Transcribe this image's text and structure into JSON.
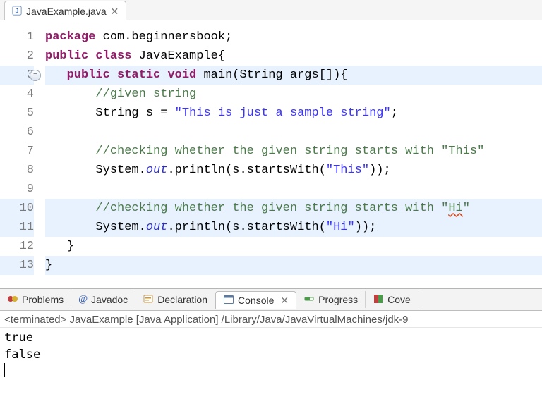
{
  "editor": {
    "filename": "JavaExample.java",
    "lines": [
      {
        "n": "1",
        "hl": false,
        "tokens": [
          {
            "t": "kw",
            "v": "package"
          },
          {
            "t": "id",
            "v": " com"
          },
          {
            "t": "id",
            "v": ".beginnersbook;"
          }
        ]
      },
      {
        "n": "2",
        "hl": false,
        "tokens": [
          {
            "t": "kw",
            "v": "public"
          },
          {
            "t": "id",
            "v": " "
          },
          {
            "t": "kw",
            "v": "class"
          },
          {
            "t": "id",
            "v": " JavaExample{"
          }
        ]
      },
      {
        "n": "3",
        "hl": true,
        "fold": true,
        "indent": "   ",
        "tokens": [
          {
            "t": "kw",
            "v": "public"
          },
          {
            "t": "id",
            "v": " "
          },
          {
            "t": "kw",
            "v": "static"
          },
          {
            "t": "id",
            "v": " "
          },
          {
            "t": "kw",
            "v": "void"
          },
          {
            "t": "id",
            "v": " main(String args[]){"
          }
        ]
      },
      {
        "n": "4",
        "hl": false,
        "indent": "       ",
        "tokens": [
          {
            "t": "cm",
            "v": "//given string"
          }
        ]
      },
      {
        "n": "5",
        "hl": false,
        "indent": "       ",
        "tokens": [
          {
            "t": "id",
            "v": "String s = "
          },
          {
            "t": "str",
            "v": "\"This is just a sample string\""
          },
          {
            "t": "id",
            "v": ";"
          }
        ]
      },
      {
        "n": "6",
        "hl": false,
        "indent": "",
        "tokens": []
      },
      {
        "n": "7",
        "hl": false,
        "indent": "       ",
        "tokens": [
          {
            "t": "cm",
            "v": "//checking whether the given string starts with \"This\""
          }
        ]
      },
      {
        "n": "8",
        "hl": false,
        "indent": "       ",
        "tokens": [
          {
            "t": "id",
            "v": "System."
          },
          {
            "t": "fld",
            "v": "out"
          },
          {
            "t": "id",
            "v": ".println(s.startsWith("
          },
          {
            "t": "str",
            "v": "\"This\""
          },
          {
            "t": "id",
            "v": "));"
          }
        ]
      },
      {
        "n": "9",
        "hl": false,
        "indent": "",
        "tokens": []
      },
      {
        "n": "10",
        "hl": true,
        "indent": "       ",
        "tokens": [
          {
            "t": "cm",
            "v": "//checking whether the given string starts with \""
          },
          {
            "t": "cm",
            "squiggle": true,
            "v": "Hi"
          },
          {
            "t": "cm",
            "v": "\""
          }
        ]
      },
      {
        "n": "11",
        "hl": true,
        "indent": "       ",
        "tokens": [
          {
            "t": "id",
            "v": "System."
          },
          {
            "t": "fld",
            "v": "out"
          },
          {
            "t": "id",
            "v": ".println(s.startsWith("
          },
          {
            "t": "str",
            "v": "\"Hi\""
          },
          {
            "t": "id",
            "v": "));"
          }
        ]
      },
      {
        "n": "12",
        "hl": false,
        "indent": "   ",
        "tokens": [
          {
            "t": "id",
            "v": "}"
          }
        ]
      },
      {
        "n": "13",
        "hl": true,
        "indent": "",
        "tokens": [
          {
            "t": "id",
            "v": "}"
          }
        ]
      }
    ]
  },
  "views": {
    "problems": "Problems",
    "javadoc": "Javadoc",
    "declaration": "Declaration",
    "console": "Console",
    "progress": "Progress",
    "coverage": "Cove"
  },
  "console": {
    "header": "<terminated> JavaExample [Java Application] /Library/Java/JavaVirtualMachines/jdk-9",
    "lines": [
      "true",
      "false"
    ]
  }
}
